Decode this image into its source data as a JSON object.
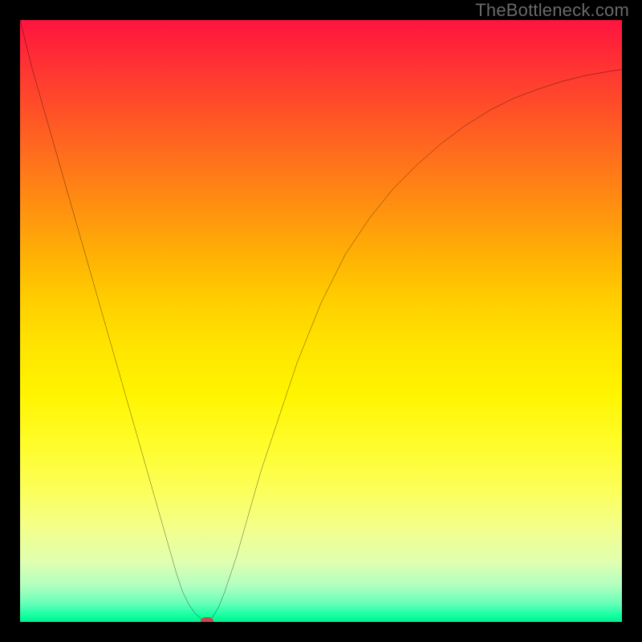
{
  "watermark": "TheBottleneck.com",
  "colors": {
    "frame": "#000000",
    "curve": "#000000",
    "marker": "#c94848",
    "gradient_top": "#ff1440",
    "gradient_bottom": "#00f090"
  },
  "chart_data": {
    "type": "line",
    "title": "",
    "xlabel": "",
    "ylabel": "",
    "xlim": [
      0,
      100
    ],
    "ylim": [
      0,
      100
    ],
    "grid": false,
    "legend": false,
    "x": [
      0,
      2,
      4,
      6,
      8,
      10,
      12,
      14,
      16,
      18,
      20,
      22,
      24,
      26,
      27,
      28,
      29,
      30,
      31,
      32,
      33,
      34,
      36,
      38,
      40,
      42,
      44,
      46,
      48,
      50,
      54,
      58,
      62,
      66,
      70,
      74,
      78,
      82,
      86,
      90,
      94,
      98,
      100
    ],
    "y": [
      100,
      92,
      85,
      78,
      71,
      64,
      57,
      50,
      43,
      36,
      29,
      22,
      15,
      8,
      5,
      3,
      1.5,
      0.6,
      0,
      0.8,
      2.5,
      5,
      11,
      18,
      25,
      31,
      37,
      43,
      48,
      53,
      61,
      67,
      72,
      76,
      79.5,
      82.5,
      85,
      87,
      88.5,
      89.8,
      90.8,
      91.5,
      91.8
    ],
    "marker": {
      "x": 31,
      "y": 0
    },
    "background": "vertical_gradient_red_to_green",
    "annotations": [
      {
        "text": "TheBottleneck.com",
        "position": "top-right"
      }
    ]
  }
}
